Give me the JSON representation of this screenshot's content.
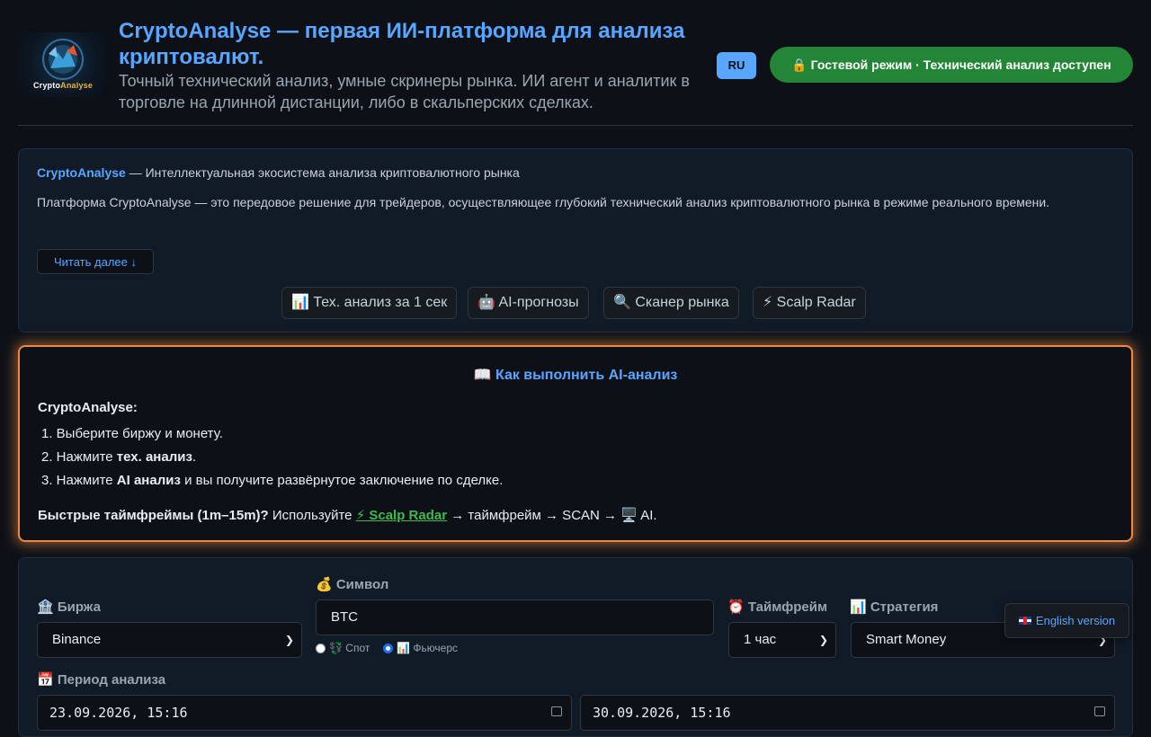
{
  "header": {
    "logo_text_part1": "Crypto",
    "logo_text_part2": "Analyse",
    "title": "CryptoAnalyse — первая ИИ-платформа для анализа криптовалют.",
    "subtitle": "Точный технический анализ, умные скринеры рынка. ИИ агент и аналитик в торговле на длинной дистанции, либо в скальперских сделках.",
    "lang_badge": "RU",
    "guest_badge": "🔒 Гостевой режим · Технический анализ доступен"
  },
  "intro": {
    "brand": "CryptoAnalyse",
    "lead_rest": " — Интеллектуальная экосистема анализа криптовалютного рынка",
    "description": "Платформа CryptoAnalyse — это передовое решение для трейдеров, осуществляющее глубокий технический анализ криптовалютного рынка в режиме реального времени.",
    "read_more": "Читать далее ↓",
    "features": [
      "📊 Тех. анализ за 1 сек",
      "🤖 AI-прогнозы",
      "🔍 Сканер рынка",
      "⚡ Scalp Radar"
    ]
  },
  "howto": {
    "title": "📖 Как выполнить AI-анализ",
    "brand_label": "CryptoAnalyse:",
    "step1": "1. Выберите биржу и монету.",
    "step2_prefix": "2. Нажмите ",
    "step2_bold": "тех. анализ",
    "step2_suffix": ".",
    "step3_prefix": "3. Нажмите ",
    "step3_bold": "AI анализ",
    "step3_suffix": " и вы получите развёрнутое заключение по сделке.",
    "quick_bold": "Быстрые таймфреймы (1m–15m)?",
    "quick_mid": " Используйте ",
    "quick_link": "⚡ Scalp Radar",
    "quick_tail": " → таймфрейм → SCAN → 🖥️ AI."
  },
  "form": {
    "exchange_label": "🏦 Биржа",
    "exchange_value": "Binance",
    "symbol_label": "💰 Символ",
    "symbol_value": "BTC",
    "spot_label": "💱 Спот",
    "futures_label": "📊 Фьючерс",
    "market_type_selected": "Фьючерс",
    "timeframe_label": "⏰ Таймфрейм",
    "timeframe_value": "1 час",
    "strategy_label": "📊 Стратегия",
    "strategy_value": "Smart Money",
    "period_label": "📅 Период анализа",
    "period_from": "23.09.2026, 15:16",
    "period_to": "30.09.2026, 15:16"
  },
  "floating": {
    "english_version": "English version"
  },
  "colors": {
    "background": "#0d1117",
    "accent": "#58a6ff",
    "success": "#238636",
    "highlight_border": "#f0883e",
    "link_green": "#3fb950"
  }
}
